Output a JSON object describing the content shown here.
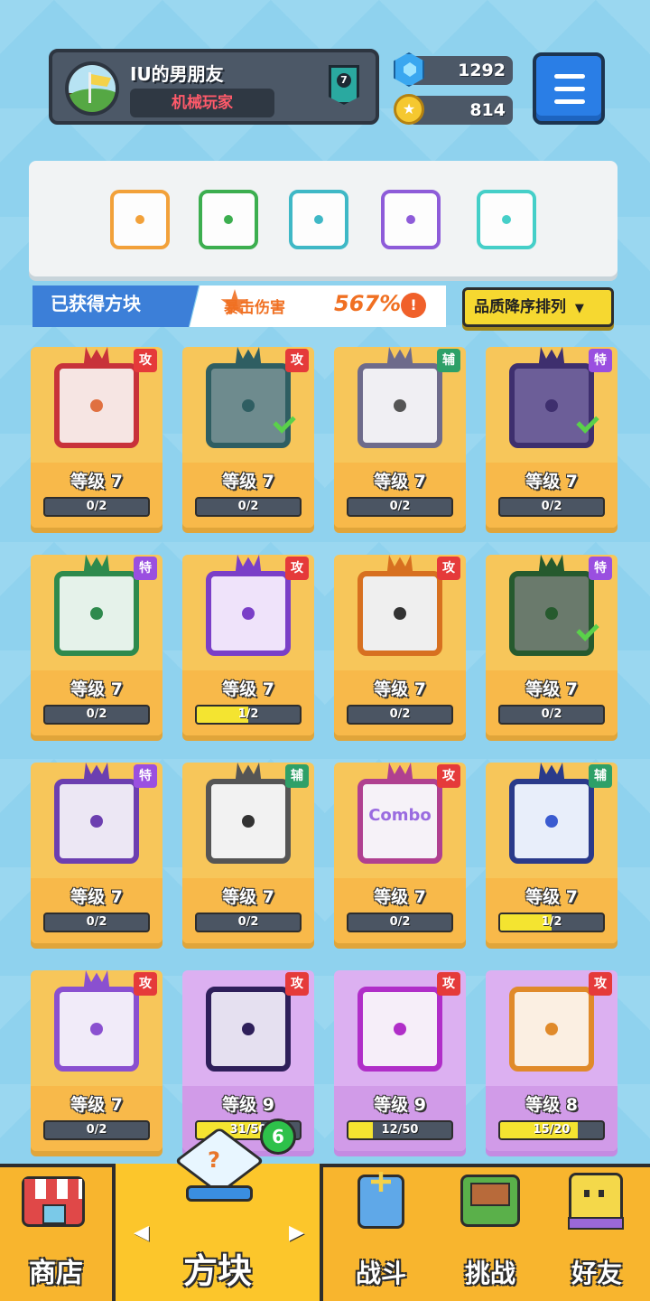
{
  "profile": {
    "name": "IU的男朋友",
    "title": "机械玩家",
    "rank": "7"
  },
  "currency": {
    "gems": "1292",
    "coins": "814"
  },
  "deck": {
    "slots": [
      {
        "color": "#f2a13a"
      },
      {
        "color": "#3cae4f"
      },
      {
        "color": "#3fb8c6"
      },
      {
        "color": "#8e5cd9"
      },
      {
        "color": "#45cfc8"
      }
    ]
  },
  "collection": {
    "label": "已获得方块",
    "crit_label": "暴击伤害",
    "crit_value": "567%",
    "info": "!",
    "sort_label": "品质降序排列",
    "sort_arrow": "▼"
  },
  "cards": [
    {
      "type": "攻",
      "type_kind": "atk",
      "level": "等级 7",
      "progress": "0/2",
      "frac": 0,
      "frame": "#c8323a",
      "bg": "#f6e5e3",
      "dot": "#e07040",
      "checked": false,
      "purple": false
    },
    {
      "type": "攻",
      "type_kind": "atk",
      "level": "等级 7",
      "progress": "0/2",
      "frac": 0,
      "frame": "#2f5e62",
      "bg": "#6e8b8e",
      "dot": "#2f5e62",
      "checked": true,
      "purple": false
    },
    {
      "type": "辅",
      "type_kind": "sup",
      "level": "等级 7",
      "progress": "0/2",
      "frac": 0,
      "frame": "#6e6b8b",
      "bg": "#f0eff3",
      "dot": "#555",
      "checked": false,
      "purple": false
    },
    {
      "type": "特",
      "type_kind": "spc",
      "level": "等级 7",
      "progress": "0/2",
      "frac": 0,
      "frame": "#3e2f6e",
      "bg": "#6c5e98",
      "dot": "#3e2f6e",
      "checked": true,
      "purple": false
    },
    {
      "type": "特",
      "type_kind": "spc",
      "level": "等级 7",
      "progress": "0/2",
      "frac": 0,
      "frame": "#2e8a4d",
      "bg": "#e5f2ea",
      "dot": "#2e8a4d",
      "checked": false,
      "purple": false
    },
    {
      "type": "攻",
      "type_kind": "atk",
      "level": "等级 7",
      "progress": "1/2",
      "frac": 0.5,
      "frame": "#7a3fc7",
      "bg": "#efe3fa",
      "dot": "#7a3fc7",
      "checked": false,
      "purple": false
    },
    {
      "type": "攻",
      "type_kind": "atk",
      "level": "等级 7",
      "progress": "0/2",
      "frac": 0,
      "frame": "#d77020",
      "bg": "#efefef",
      "dot": "#333",
      "checked": false,
      "purple": false
    },
    {
      "type": "特",
      "type_kind": "spc",
      "level": "等级 7",
      "progress": "0/2",
      "frac": 0,
      "frame": "#265a2e",
      "bg": "#6a7a6c",
      "dot": "#265a2e",
      "checked": true,
      "purple": false
    },
    {
      "type": "特",
      "type_kind": "spc",
      "level": "等级 7",
      "progress": "0/2",
      "frac": 0,
      "frame": "#6c3fb0",
      "bg": "#ece7f4",
      "dot": "#6c3fb0",
      "checked": false,
      "purple": false
    },
    {
      "type": "辅",
      "type_kind": "sup",
      "level": "等级 7",
      "progress": "0/2",
      "frac": 0,
      "frame": "#555",
      "bg": "#f2f2f2",
      "dot": "#333",
      "checked": false,
      "purple": false
    },
    {
      "type": "攻",
      "type_kind": "atk",
      "level": "等级 7",
      "progress": "0/2",
      "frac": 0,
      "frame": "#b04090",
      "bg": "#f6f2f8",
      "dot": "#9a6ce0",
      "checked": false,
      "purple": false,
      "text": "Combo"
    },
    {
      "type": "辅",
      "type_kind": "sup",
      "level": "等级 7",
      "progress": "1/2",
      "frac": 0.5,
      "frame": "#2a3a8a",
      "bg": "#e8eefa",
      "dot": "#3a5bd0",
      "checked": false,
      "purple": false
    },
    {
      "type": "攻",
      "type_kind": "atk",
      "level": "等级 7",
      "progress": "0/2",
      "frac": 0,
      "frame": "#8a50d0",
      "bg": "#f1ebf9",
      "dot": "#8a50d0",
      "checked": false,
      "purple": false
    },
    {
      "type": "攻",
      "type_kind": "atk",
      "level": "等级 9",
      "progress": "31/50",
      "frac": 0.62,
      "frame": "#2e1f5a",
      "bg": "#e5e0f0",
      "dot": "#2e1f5a",
      "checked": false,
      "purple": true
    },
    {
      "type": "攻",
      "type_kind": "atk",
      "level": "等级 9",
      "progress": "12/50",
      "frac": 0.24,
      "frame": "#b02ec8",
      "bg": "#f6eef9",
      "dot": "#b02ec8",
      "checked": false,
      "purple": true
    },
    {
      "type": "攻",
      "type_kind": "atk",
      "level": "等级 8",
      "progress": "15/20",
      "frac": 0.75,
      "frame": "#e08a2a",
      "bg": "#fbefe2",
      "dot": "#e08a2a",
      "checked": false,
      "purple": true
    }
  ],
  "nav": {
    "shop": "商店",
    "blocks": "方块",
    "battle": "战斗",
    "challenge": "挑战",
    "friends": "好友",
    "new_count": "6",
    "prev": "◀",
    "next": "▶"
  }
}
